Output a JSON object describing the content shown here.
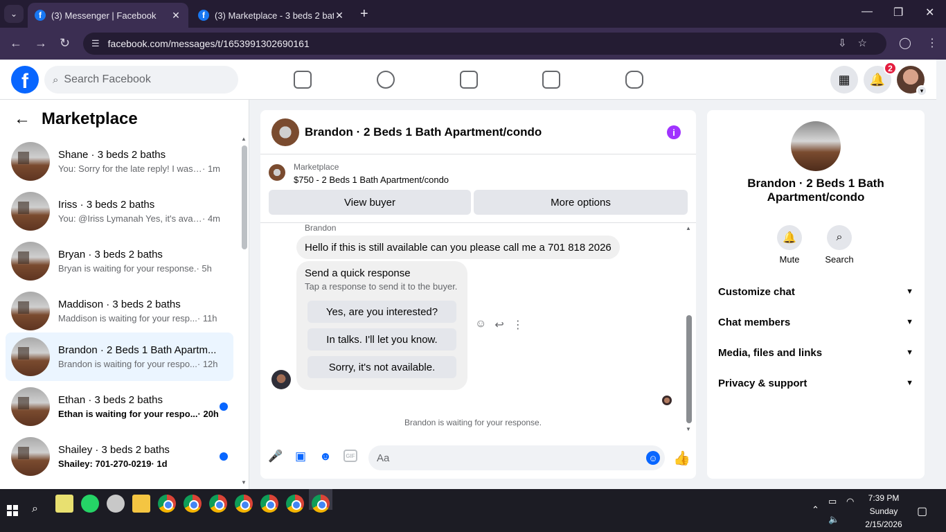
{
  "browser": {
    "tabs": [
      {
        "title": "(3) Messenger | Facebook",
        "active": true
      },
      {
        "title": "(3) Marketplace - 3 beds 2 bath",
        "active": false
      }
    ],
    "url": "facebook.com/messages/t/1653991302690161"
  },
  "header": {
    "search_placeholder": "Search Facebook",
    "notifications_count": "2"
  },
  "sidebar": {
    "title": "Marketplace",
    "conversations": [
      {
        "name": "Shane · 3 beds 2 baths",
        "preview": "You: Sorry for the late reply! I was ...",
        "time": " · 1m",
        "unread": false,
        "active": false
      },
      {
        "name": "Iriss · 3 beds 2 baths",
        "preview": "You: @Iriss Lymanah Yes, it's availa...",
        "time": " · 4m",
        "unread": false,
        "active": false
      },
      {
        "name": "Bryan · 3 beds 2 baths",
        "preview": "Bryan is waiting for your response.",
        "time": " · 5h",
        "unread": false,
        "active": false
      },
      {
        "name": "Maddison · 3 beds 2 baths",
        "preview": "Maddison is waiting for your resp...",
        "time": " · 11h",
        "unread": false,
        "active": false
      },
      {
        "name": "Brandon · 2 Beds 1 Bath Apartm...",
        "preview": "Brandon is waiting for your respo...",
        "time": " · 12h",
        "unread": false,
        "active": true
      },
      {
        "name": "Ethan · 3 beds 2 baths",
        "preview": "Ethan is waiting for your respo...",
        "time": " · 20h",
        "unread": true,
        "active": false
      },
      {
        "name": "Shailey · 3 beds 2 baths",
        "preview": "Shailey: 701-270-0219",
        "time": " · 1d",
        "unread": true,
        "active": false
      }
    ]
  },
  "chat": {
    "title": "Brandon · 2 Beds 1 Bath Apartment/condo",
    "marketplace_label": "Marketplace",
    "listing": "$750 - 2 Beds 1 Bath Apartment/condo",
    "view_buyer": "View buyer",
    "more_options": "More options",
    "sender": "Brandon",
    "message": "Hello if this is still available can you please call me a 701 818 2026",
    "quick_title": "Send a quick response",
    "quick_subtitle": "Tap a response to send it to the buyer.",
    "quick_responses": [
      "Yes, are you interested?",
      "In talks. I'll let you know.",
      "Sorry, it's not available."
    ],
    "status": "Brandon is waiting for your response.",
    "input_placeholder": "Aa",
    "gif_label": "GIF"
  },
  "right_panel": {
    "name": "Brandon · 2 Beds 1 Bath Apartment/condo",
    "mute": "Mute",
    "search": "Search",
    "sections": [
      "Customize chat",
      "Chat members",
      "Media, files and links",
      "Privacy & support"
    ]
  },
  "taskbar": {
    "time": "7:39 PM",
    "day": "Sunday",
    "date": "2/15/2026"
  },
  "colors": {
    "fb_blue": "#0866ff",
    "tab_bg": "#241c33",
    "active_row": "#ebf5ff",
    "info_purple": "#a033ff"
  }
}
